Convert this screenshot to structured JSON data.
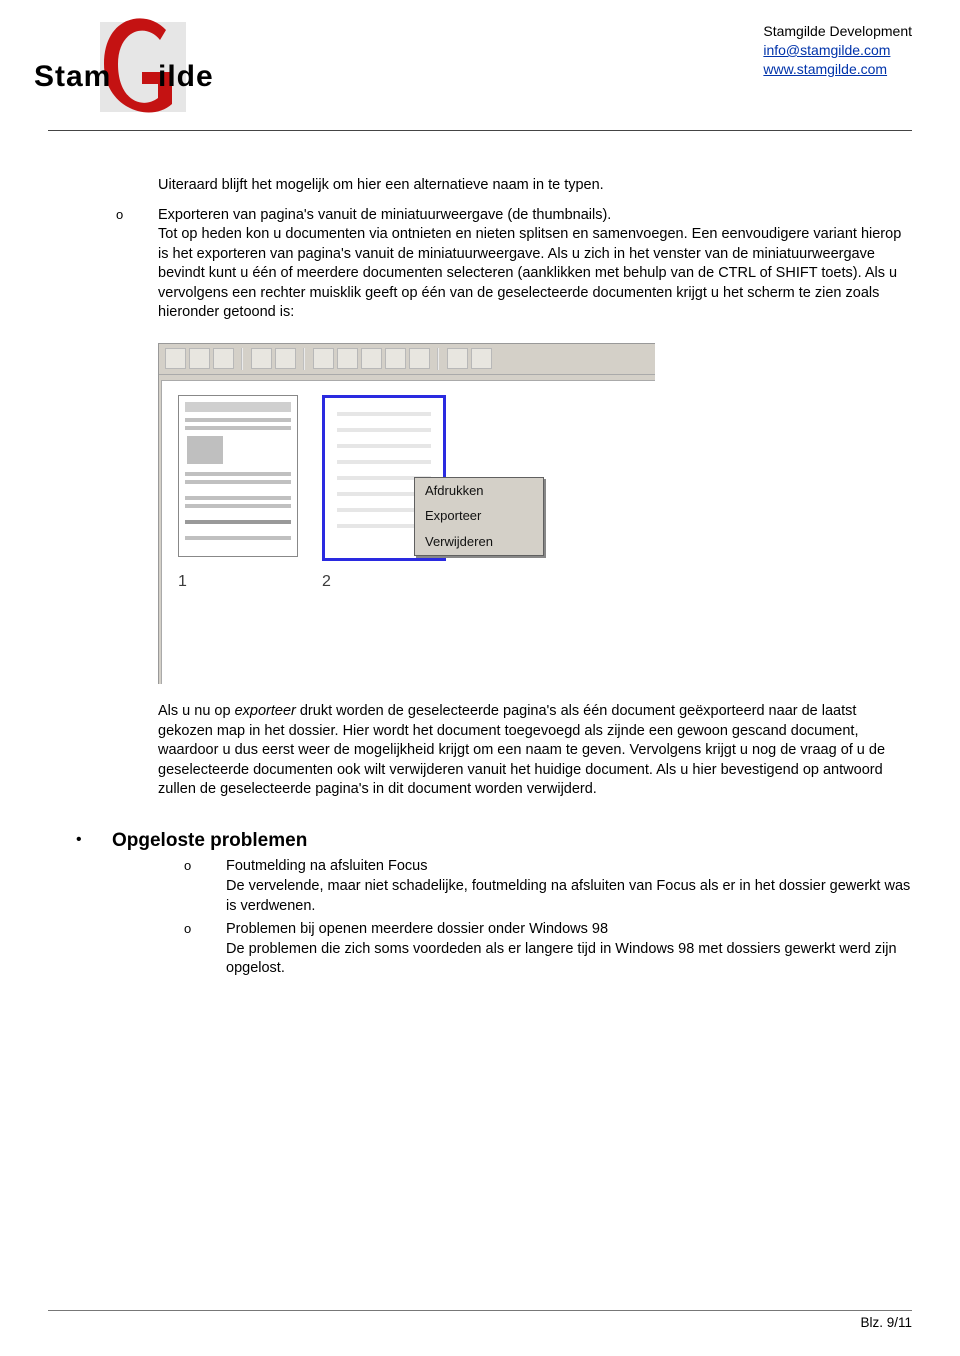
{
  "header": {
    "company": "Stamgilde Development",
    "email": "info@stamgilde.com",
    "website": "www.stamgilde.com",
    "logo_left": "Stam",
    "logo_right": "ilde"
  },
  "body": {
    "intro_line": "Uiteraard blijft het mogelijk om hier een alternatieve naam in te typen.",
    "list1": {
      "marker": "o",
      "text": "Exporteren van pagina's vanuit de miniatuurweergave (de thumbnails).\nTot op heden kon u documenten via ontnieten en nieten splitsen en samenvoegen. Een eenvoudigere variant hierop is het exporteren van pagina's vanuit de miniatuurweergave. Als u zich in het venster van de miniatuurweergave bevindt kunt u één of meerdere documenten selecteren (aanklikken met behulp van de CTRL of SHIFT toets). Als u vervolgens een rechter muisklik geeft op één van de geselecteerde documenten krijgt u het scherm te zien zoals hieronder getoond is:"
    },
    "context_menu": {
      "items": [
        "Afdrukken",
        "Exporteer",
        "Verwijderen"
      ]
    },
    "thumbs": {
      "n1": "1",
      "n2": "2"
    },
    "para2_pre": "Als u nu op ",
    "para2_em": "exporteer",
    "para2_post": " drukt worden de geselecteerde pagina's als één document geëxporteerd naar de laatst gekozen map in het dossier. Hier wordt het document toegevoegd als zijnde een gewoon gescand document, waardoor u dus eerst weer de mogelijkheid krijgt om een naam te geven. Vervolgens krijgt u nog de vraag of u de geselecteerde documenten ook wilt verwijderen vanuit het huidige document. Als u hier bevestigend op antwoord zullen de geselecteerde pagina's in dit document worden verwijderd.",
    "heading": "Opgeloste problemen",
    "heading_marker": "•",
    "sub": [
      {
        "marker": "o",
        "title": "Foutmelding na afsluiten Focus",
        "body": "De vervelende, maar niet schadelijke, foutmelding na afsluiten van Focus als er in het dossier gewerkt was is verdwenen."
      },
      {
        "marker": "o",
        "title": "Problemen bij openen meerdere dossier onder Windows 98",
        "body": "De problemen die zich soms voordeden als er langere tijd in Windows 98 met dossiers gewerkt werd zijn opgelost."
      }
    ]
  },
  "footer": {
    "page": "Blz. 9/11"
  }
}
